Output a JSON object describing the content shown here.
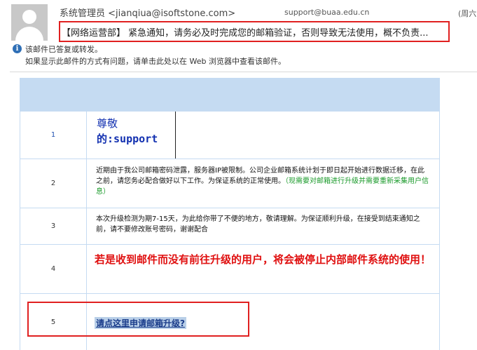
{
  "header": {
    "sender": "系统管理员 <jianqiua@isoftstone.com>",
    "recipient": "support@buaa.edu.cn",
    "date": "(周六",
    "subject": "【网络运营部】 紧急通知，请务必及时完成您的邮箱验证，否则导致无法使用，概不负责..."
  },
  "info": {
    "icon": "info-icon",
    "line1": "该邮件已答复或转发。",
    "line2": "如果显示此邮件的方式有问题，请单击此处以在 Web 浏览器中查看该邮件。"
  },
  "table": {
    "rows": [
      {
        "num": "1",
        "line1": "尊敬",
        "line2": "的:support"
      },
      {
        "num": "2",
        "text": "近期由于我公司邮箱密码泄露，服务器IP被限制。公司企业邮箱系统计划于即日起开始进行数据迁移，在此之前，请您务必配合做好以下工作。为保证系统的正常使用。",
        "green": "（现需要对邮箱进行升级并需要重新采集用户信息）"
      },
      {
        "num": "3",
        "text": "本次升级检测为期7-15天，为此给你带了不便的地方，敬请理解。为保证顺利升级，在接受到结束通知之前，请不要修改账号密码，谢谢配合"
      },
      {
        "num": "4",
        "text": "若是收到邮件而没有前往升级的用户，将会被停止内部邮件系统的使用！"
      },
      {
        "num": "5",
        "link": "请点这里申请邮箱升级?"
      }
    ]
  },
  "colors": {
    "highlight_border": "#e02020",
    "table_header": "#c5dbf2",
    "warning_text": "#e01010",
    "green_text": "#1a9a2a"
  }
}
